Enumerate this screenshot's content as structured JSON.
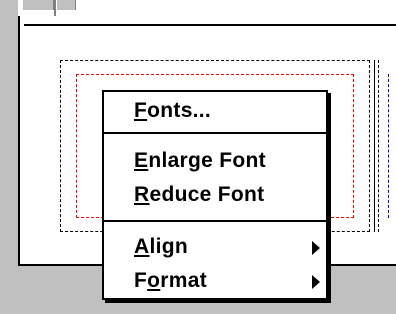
{
  "menu": {
    "items": [
      {
        "key": "fonts",
        "mnemonic": "F",
        "rest": "onts...",
        "submenu": false
      },
      {
        "key": "enlarge",
        "mnemonic": "E",
        "rest": "nlarge Font",
        "submenu": false
      },
      {
        "key": "reduce",
        "mnemonic": "R",
        "rest": "educe Font",
        "submenu": false
      },
      {
        "key": "align",
        "mnemonic": "A",
        "rest": "lign",
        "submenu": true
      },
      {
        "key": "format",
        "pre": "F",
        "mnemonic": "o",
        "rest": "rmat",
        "submenu": true
      }
    ]
  },
  "colors": {
    "page": "#c0c0c0",
    "menu_bg": "#ffffff",
    "selection_outline": "#ff0000",
    "column_guide": "#0000ff"
  },
  "icons": {
    "submenu_arrow": "submenu-arrow-icon"
  }
}
